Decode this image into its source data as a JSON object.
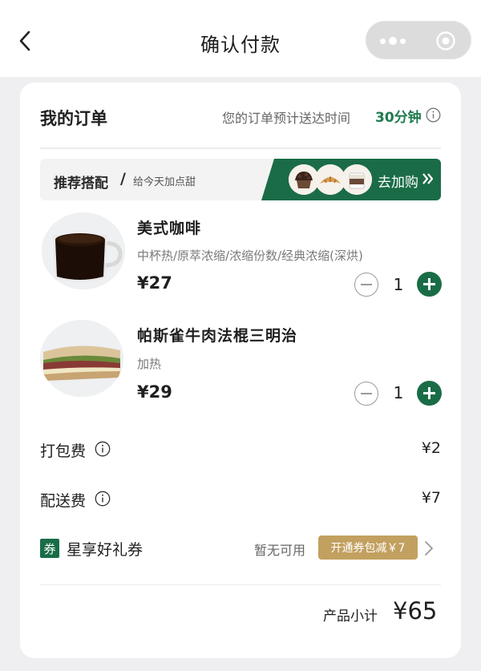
{
  "header": {
    "title": "确认付款",
    "back_icon": "chevron-left-icon",
    "menu_icon": "more-dots-icon",
    "close_icon": "target-circle-icon"
  },
  "order": {
    "title": "我的订单",
    "eta_text": "您的订单预计送达时间",
    "eta_value": "30分钟",
    "eta_info_icon": "info-icon"
  },
  "recommendation": {
    "title": "推荐搭配",
    "slash": "/",
    "subtitle": "给今天加点甜",
    "action": "去加购",
    "action_icon": "double-chevron-right-icon"
  },
  "products": [
    {
      "name": "美式咖啡",
      "spec": "中杯热/原萃浓缩/浓缩份数/经典浓缩(深烘)",
      "price": "¥27",
      "quantity": "1",
      "image": "americano-cup-image"
    },
    {
      "name": "帕斯雀牛肉法棍三明治",
      "spec": "加热",
      "price": "¥29",
      "quantity": "1",
      "image": "beef-baguette-sandwich-image"
    }
  ],
  "fees": [
    {
      "label": "打包费",
      "value": "¥2"
    },
    {
      "label": "配送费",
      "value": "¥7"
    }
  ],
  "coupon": {
    "badge": "券",
    "title": "星享好礼券",
    "status": "暂无可用",
    "promo": "开通券包减￥7"
  },
  "summary": {
    "label": "产品小计",
    "value": "¥65"
  },
  "colors": {
    "accent_green": "#1a6c47",
    "eta_green": "#1e7b4f",
    "promo_gold": "#c2a05f",
    "page_bg": "#efeff1"
  }
}
